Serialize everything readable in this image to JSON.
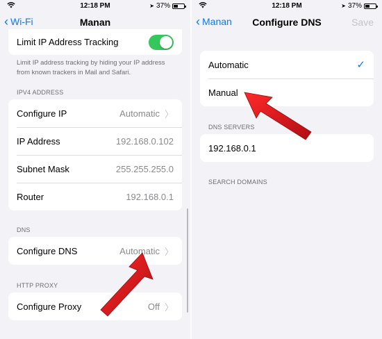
{
  "status_bar": {
    "time": "12:18 PM",
    "battery": "37%",
    "battery_level": 0.37,
    "icons": [
      "wifi-icon",
      "location-arrow-icon",
      "battery-icon"
    ]
  },
  "left": {
    "nav": {
      "back_label": "Wi-Fi",
      "title": "Manan"
    },
    "limit_ip": {
      "label": "Limit IP Address Tracking",
      "toggle_on": true,
      "footnote": "Limit IP address tracking by hiding your IP address from known trackers in Mail and Safari."
    },
    "ipv4": {
      "header": "IPV4 ADDRESS",
      "rows": [
        {
          "label": "Configure IP",
          "value": "Automatic"
        },
        {
          "label": "IP Address",
          "value": "192.168.0.102"
        },
        {
          "label": "Subnet Mask",
          "value": "255.255.255.0"
        },
        {
          "label": "Router",
          "value": "192.168.0.1"
        }
      ]
    },
    "dns": {
      "header": "DNS",
      "label": "Configure DNS",
      "value": "Automatic"
    },
    "proxy": {
      "header": "HTTP PROXY",
      "label": "Configure Proxy",
      "value": "Off"
    }
  },
  "right": {
    "nav": {
      "back_label": "Manan",
      "title": "Configure DNS",
      "save_label": "Save"
    },
    "options": [
      {
        "label": "Automatic",
        "selected": true
      },
      {
        "label": "Manual",
        "selected": false
      }
    ],
    "dns_servers": {
      "header": "DNS SERVERS",
      "value": "192.168.0.1"
    },
    "search_domains": {
      "header": "SEARCH DOMAINS"
    }
  },
  "colors": {
    "accent": "#0a7aff",
    "toggle_on": "#34c759",
    "annotation_arrow": "#e8141a",
    "background": "#f2f2f7"
  }
}
